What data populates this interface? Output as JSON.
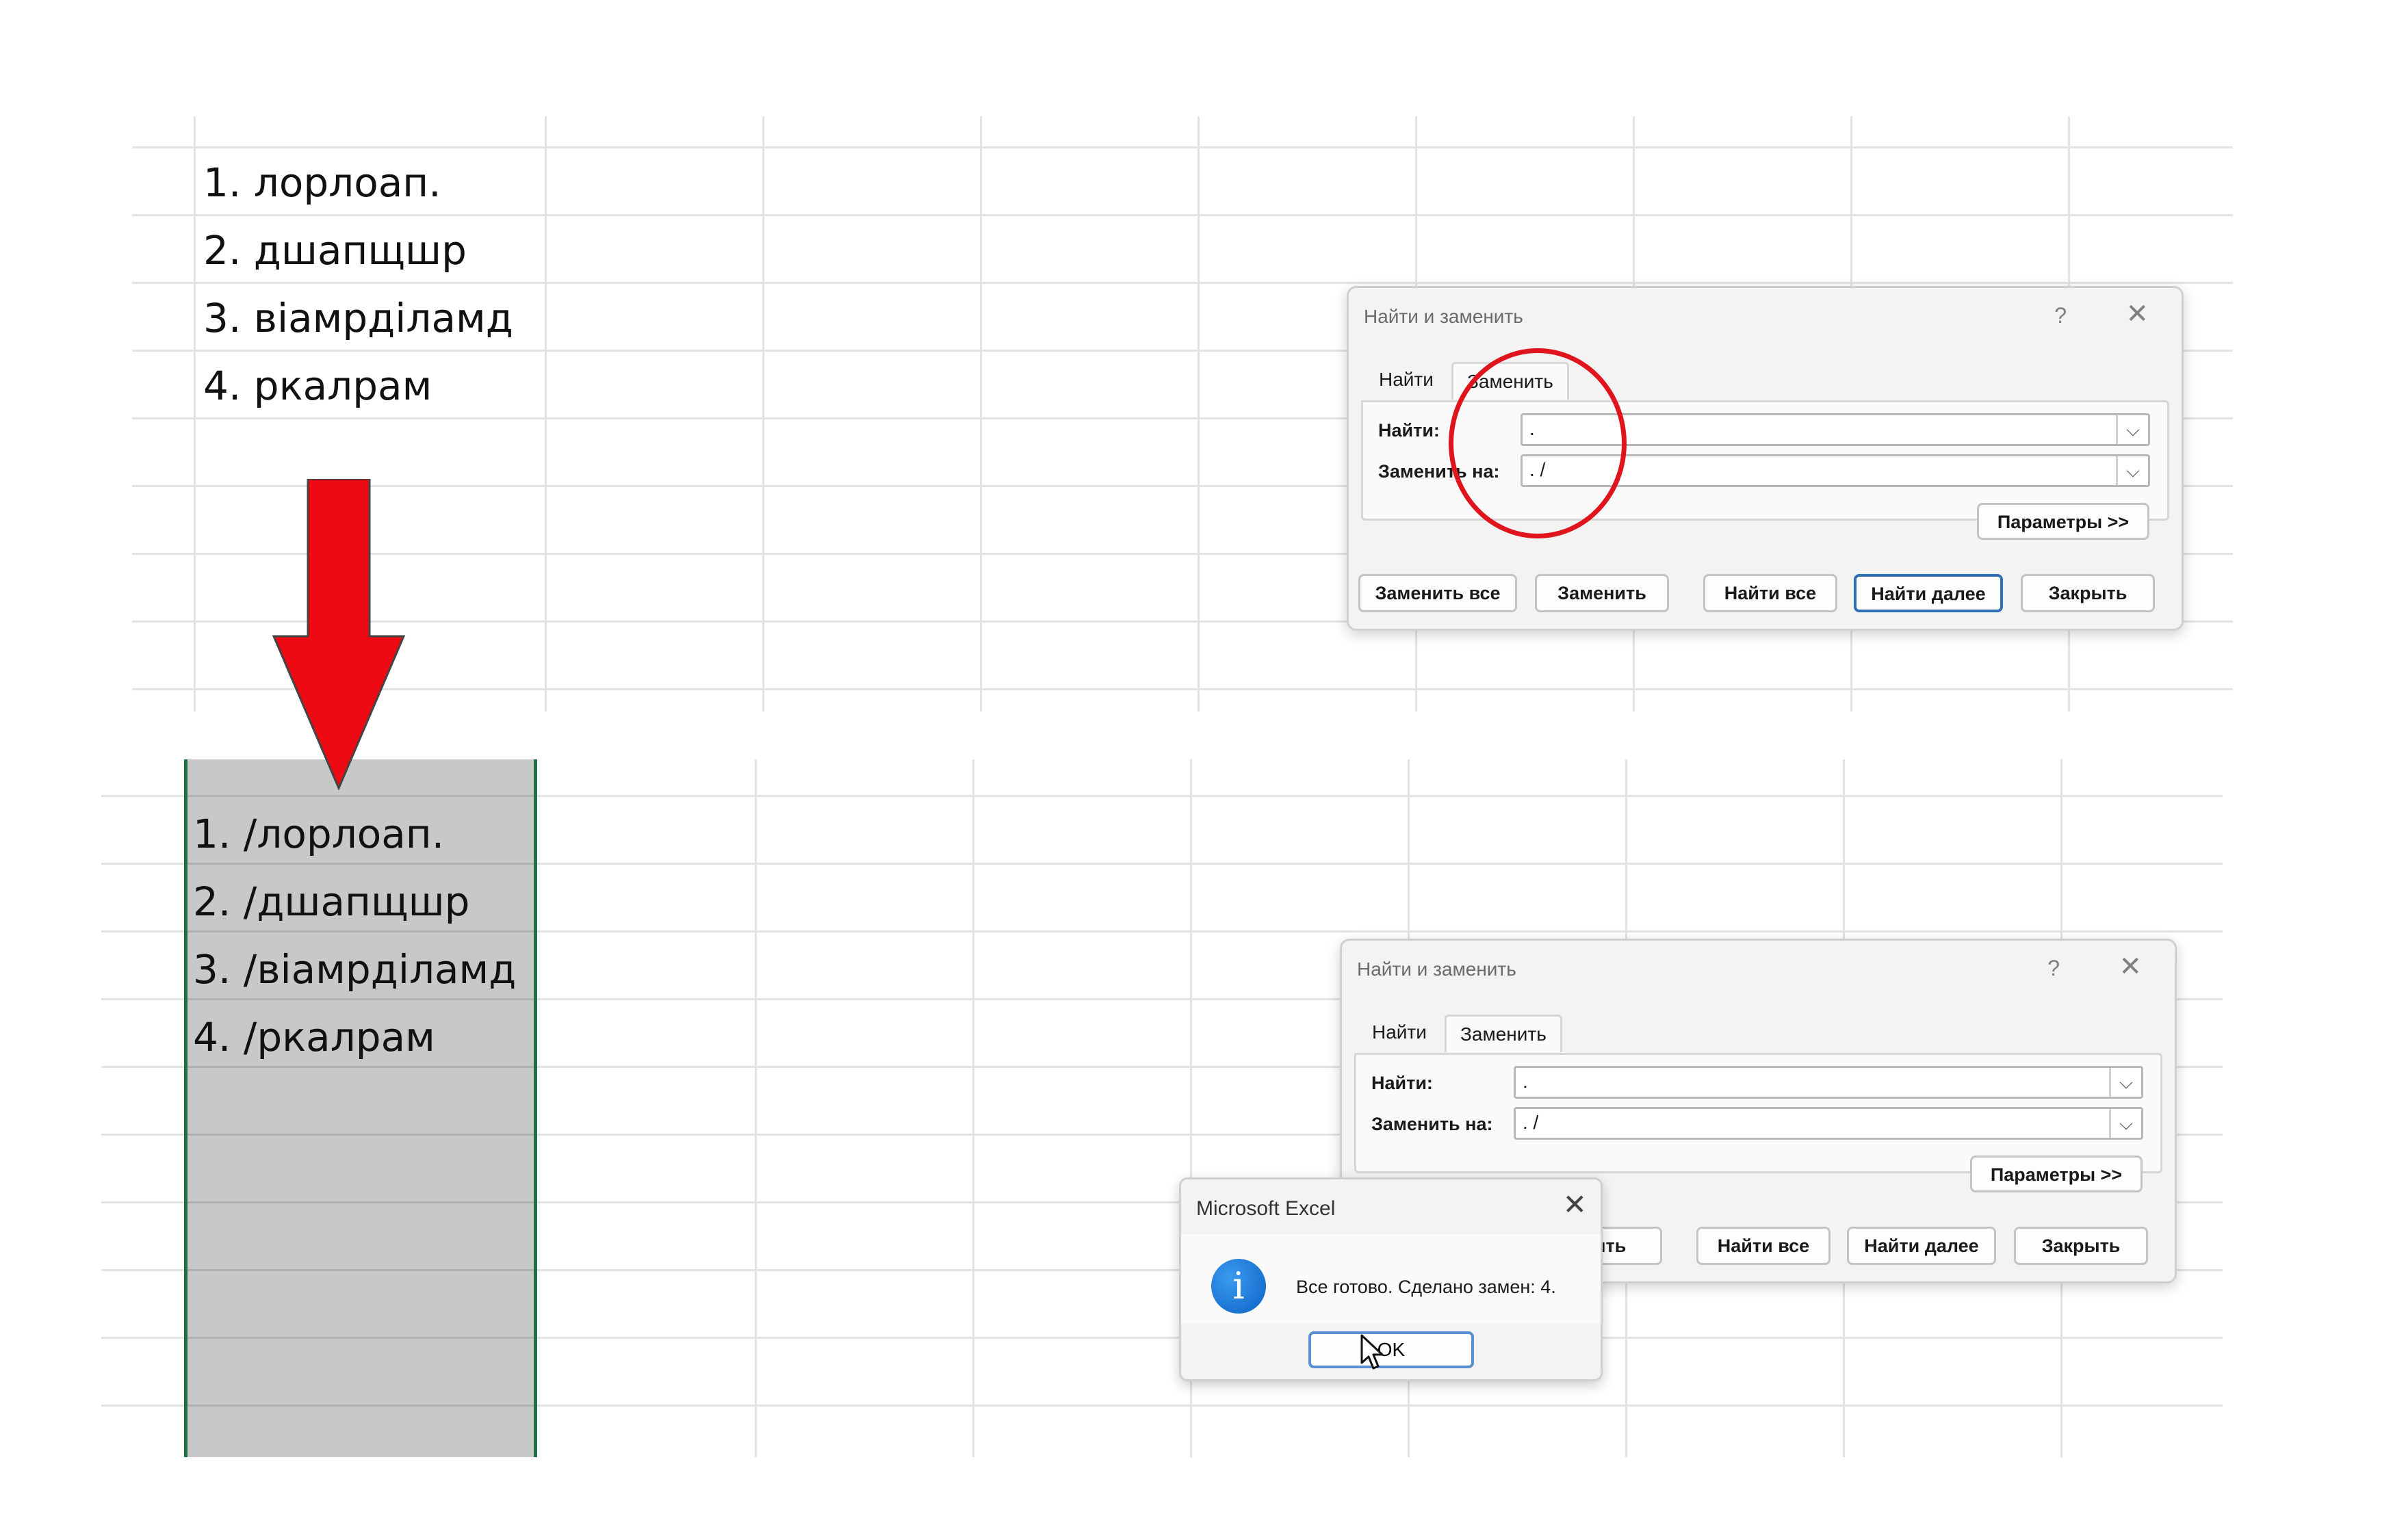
{
  "top_sheet": {
    "cells": [
      "1. лорлоап.",
      "2. дшапщшр",
      "3. віамрділамд",
      "4. ркалрам"
    ]
  },
  "bottom_sheet": {
    "cells": [
      "1. /лорлоап.",
      "2. /дшапщшр",
      "3. /віамрділамд",
      "4. /ркалрам"
    ]
  },
  "dialog": {
    "title": "Найти и заменить",
    "help": "?",
    "tab_find": "Найти",
    "tab_replace": "Заменить",
    "find_label": "Найти:",
    "replace_label": "Заменить на:",
    "find_value": ".",
    "replace_value": ". /",
    "params_button": "Параметры >>",
    "replace_all_button": "Заменить все",
    "replace_button": "Заменить",
    "find_all_button": "Найти все",
    "find_next_button": "Найти далее",
    "close_button": "Закрыть"
  },
  "bottom_dialog": {
    "replace_button_partial": "нить"
  },
  "message_box": {
    "title": "Microsoft Excel",
    "text": "Все готово. Сделано замен: 4.",
    "ok_button": "OK"
  },
  "colors": {
    "annotation_red": "#e0141c",
    "selection_border": "#1e7145",
    "default_button_border": "#2f6fb5"
  },
  "icons": [
    "info-icon",
    "close-icon",
    "chevron-down-icon",
    "down-arrow-annotation",
    "mouse-cursor-icon"
  ]
}
